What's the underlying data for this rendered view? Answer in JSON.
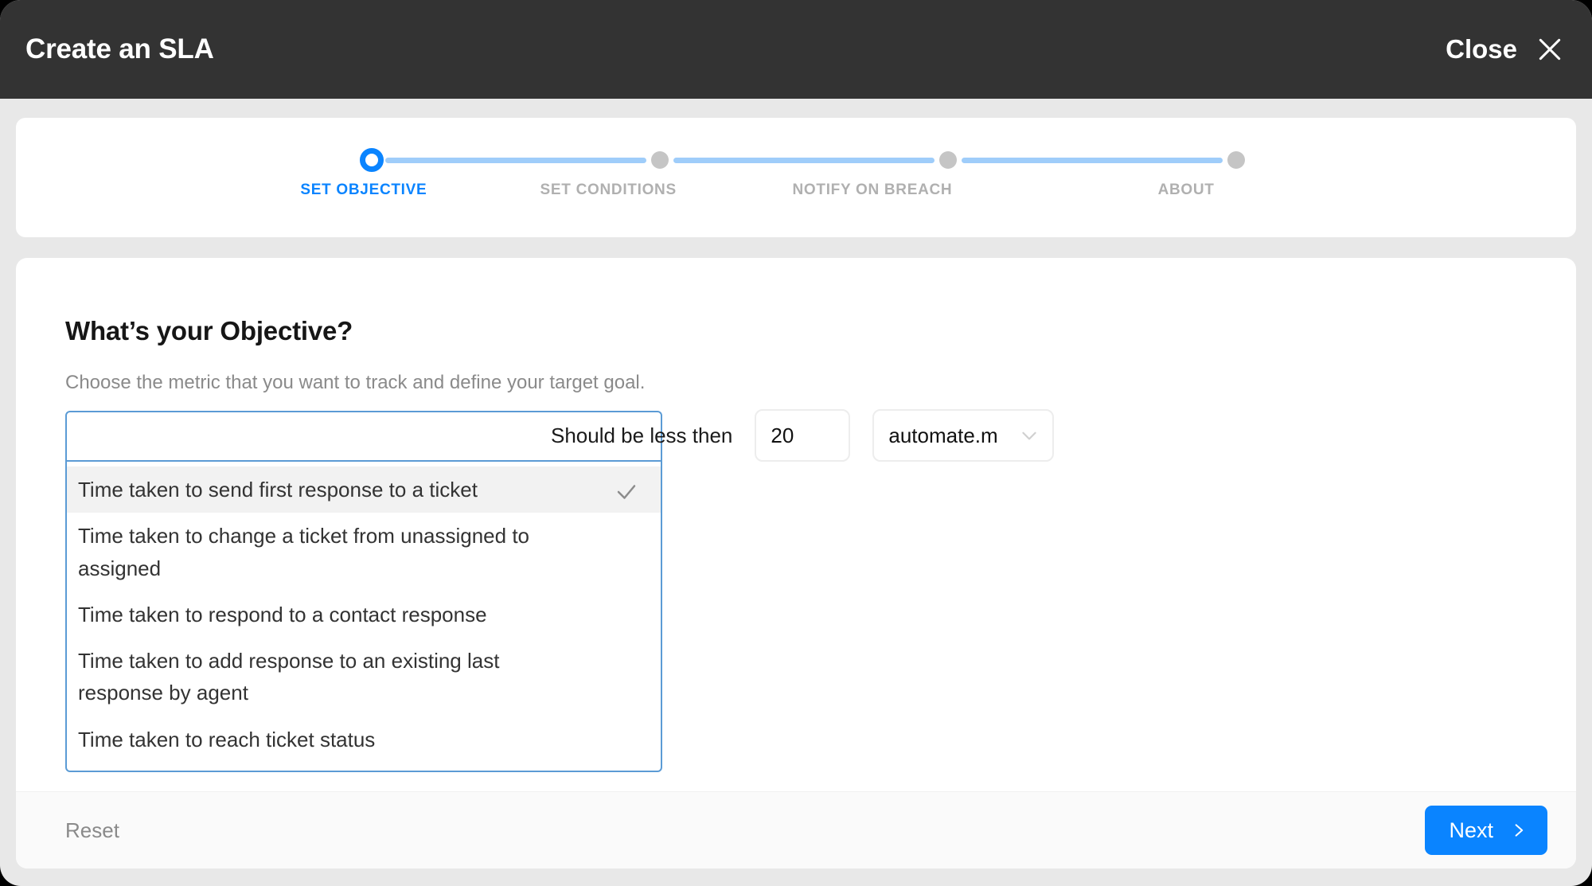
{
  "header": {
    "title": "Create an SLA",
    "close_label": "Close",
    "close_icon": "close-x-icon"
  },
  "stepper": {
    "steps": [
      {
        "label": "SET OBJECTIVE",
        "state": "active"
      },
      {
        "label": "SET CONDITIONS",
        "state": "idle"
      },
      {
        "label": "NOTIFY ON BREACH",
        "state": "idle"
      },
      {
        "label": "ABOUT",
        "state": "idle"
      }
    ],
    "active_color": "#0a84ff",
    "idle_color": "#c5c5c5",
    "line_color": "#9fcdfa"
  },
  "objective": {
    "title": "What’s your Objective?",
    "subtitle": "Choose the metric that you want to track and define your target goal.",
    "combo": {
      "value": "",
      "placeholder": "",
      "expanded": true,
      "check_icon": "check-icon",
      "options": [
        {
          "label": "Time taken to send first response to a ticket",
          "selected": true
        },
        {
          "label": "Time taken to change a ticket from unassigned to assigned",
          "selected": false
        },
        {
          "label": "Time taken to respond to a contact response",
          "selected": false
        },
        {
          "label": "Time taken to add response to an existing last response by agent",
          "selected": false
        },
        {
          "label": "Time taken to reach ticket status",
          "selected": false
        }
      ]
    },
    "target": {
      "condition_label": "Should be less then",
      "value": "20",
      "unit": "automate.m",
      "unit_chevron_icon": "chevron-down-icon"
    }
  },
  "footer": {
    "reset_label": "Reset",
    "next_label": "Next",
    "next_icon": "chevron-right-icon",
    "next_color": "#0a84ff"
  }
}
